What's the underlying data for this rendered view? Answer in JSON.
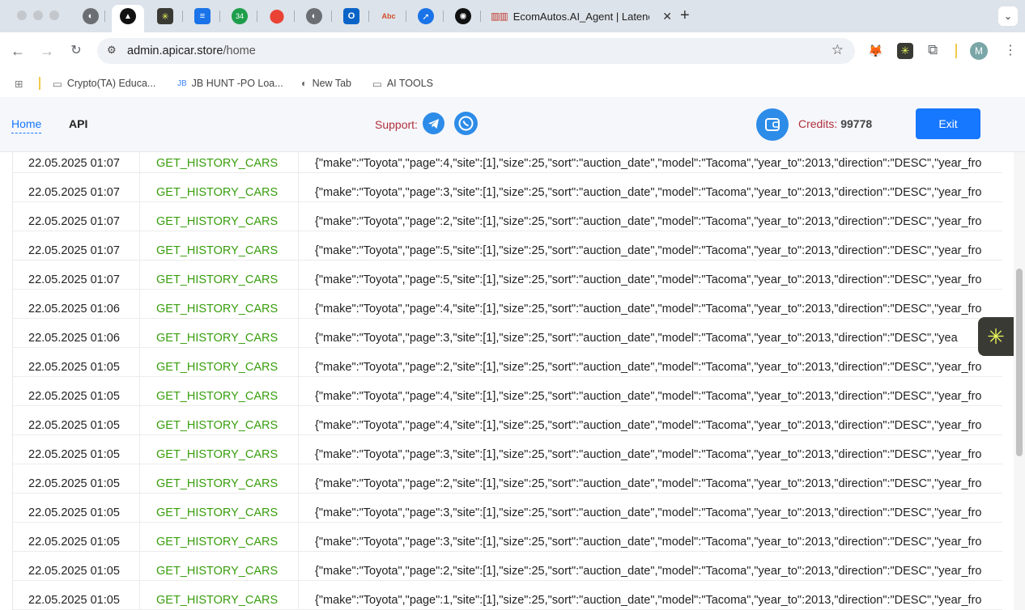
{
  "browser": {
    "active_tab_title": "EcomAutos.AI_Agent | Latenc",
    "url_host": "admin.apicar.store",
    "url_path": "/home",
    "tab_badge_count": "34",
    "tab_text_icon": "Abc",
    "profile_initial": "M",
    "bookmarks": [
      "Crypto(TA) Educa...",
      "JB HUNT -PO Loa...",
      "New Tab",
      "AI TOOLS"
    ]
  },
  "header": {
    "nav_home": "Home",
    "nav_api": "API",
    "support_label": "Support:",
    "credits_label": "Credits:",
    "credits_value": "99778",
    "exit_label": "Exit"
  },
  "table": {
    "rows": [
      {
        "time": "22.05.2025 01:07",
        "method": "GET_HISTORY_CARS",
        "params": "{\"make\":\"Toyota\",\"page\":4,\"site\":[1],\"size\":25,\"sort\":\"auction_date\",\"model\":\"Tacoma\",\"year_to\":2013,\"direction\":\"DESC\",\"year_fro"
      },
      {
        "time": "22.05.2025 01:07",
        "method": "GET_HISTORY_CARS",
        "params": "{\"make\":\"Toyota\",\"page\":3,\"site\":[1],\"size\":25,\"sort\":\"auction_date\",\"model\":\"Tacoma\",\"year_to\":2013,\"direction\":\"DESC\",\"year_fro"
      },
      {
        "time": "22.05.2025 01:07",
        "method": "GET_HISTORY_CARS",
        "params": "{\"make\":\"Toyota\",\"page\":2,\"site\":[1],\"size\":25,\"sort\":\"auction_date\",\"model\":\"Tacoma\",\"year_to\":2013,\"direction\":\"DESC\",\"year_fro"
      },
      {
        "time": "22.05.2025 01:07",
        "method": "GET_HISTORY_CARS",
        "params": "{\"make\":\"Toyota\",\"page\":5,\"site\":[1],\"size\":25,\"sort\":\"auction_date\",\"model\":\"Tacoma\",\"year_to\":2013,\"direction\":\"DESC\",\"year_fro"
      },
      {
        "time": "22.05.2025 01:07",
        "method": "GET_HISTORY_CARS",
        "params": "{\"make\":\"Toyota\",\"page\":5,\"site\":[1],\"size\":25,\"sort\":\"auction_date\",\"model\":\"Tacoma\",\"year_to\":2013,\"direction\":\"DESC\",\"year_fro"
      },
      {
        "time": "22.05.2025 01:06",
        "method": "GET_HISTORY_CARS",
        "params": "{\"make\":\"Toyota\",\"page\":4,\"site\":[1],\"size\":25,\"sort\":\"auction_date\",\"model\":\"Tacoma\",\"year_to\":2013,\"direction\":\"DESC\",\"year_fro"
      },
      {
        "time": "22.05.2025 01:06",
        "method": "GET_HISTORY_CARS",
        "params": "{\"make\":\"Toyota\",\"page\":3,\"site\":[1],\"size\":25,\"sort\":\"auction_date\",\"model\":\"Tacoma\",\"year_to\":2013,\"direction\":\"DESC\",\"yea"
      },
      {
        "time": "22.05.2025 01:05",
        "method": "GET_HISTORY_CARS",
        "params": "{\"make\":\"Toyota\",\"page\":2,\"site\":[1],\"size\":25,\"sort\":\"auction_date\",\"model\":\"Tacoma\",\"year_to\":2013,\"direction\":\"DESC\",\"year_fro"
      },
      {
        "time": "22.05.2025 01:05",
        "method": "GET_HISTORY_CARS",
        "params": "{\"make\":\"Toyota\",\"page\":4,\"site\":[1],\"size\":25,\"sort\":\"auction_date\",\"model\":\"Tacoma\",\"year_to\":2013,\"direction\":\"DESC\",\"year_fro"
      },
      {
        "time": "22.05.2025 01:05",
        "method": "GET_HISTORY_CARS",
        "params": "{\"make\":\"Toyota\",\"page\":4,\"site\":[1],\"size\":25,\"sort\":\"auction_date\",\"model\":\"Tacoma\",\"year_to\":2013,\"direction\":\"DESC\",\"year_fro"
      },
      {
        "time": "22.05.2025 01:05",
        "method": "GET_HISTORY_CARS",
        "params": "{\"make\":\"Toyota\",\"page\":3,\"site\":[1],\"size\":25,\"sort\":\"auction_date\",\"model\":\"Tacoma\",\"year_to\":2013,\"direction\":\"DESC\",\"year_fro"
      },
      {
        "time": "22.05.2025 01:05",
        "method": "GET_HISTORY_CARS",
        "params": "{\"make\":\"Toyota\",\"page\":2,\"site\":[1],\"size\":25,\"sort\":\"auction_date\",\"model\":\"Tacoma\",\"year_to\":2013,\"direction\":\"DESC\",\"year_fro"
      },
      {
        "time": "22.05.2025 01:05",
        "method": "GET_HISTORY_CARS",
        "params": "{\"make\":\"Toyota\",\"page\":3,\"site\":[1],\"size\":25,\"sort\":\"auction_date\",\"model\":\"Tacoma\",\"year_to\":2013,\"direction\":\"DESC\",\"year_fro"
      },
      {
        "time": "22.05.2025 01:05",
        "method": "GET_HISTORY_CARS",
        "params": "{\"make\":\"Toyota\",\"page\":3,\"site\":[1],\"size\":25,\"sort\":\"auction_date\",\"model\":\"Tacoma\",\"year_to\":2013,\"direction\":\"DESC\",\"year_fro"
      },
      {
        "time": "22.05.2025 01:05",
        "method": "GET_HISTORY_CARS",
        "params": "{\"make\":\"Toyota\",\"page\":2,\"site\":[1],\"size\":25,\"sort\":\"auction_date\",\"model\":\"Tacoma\",\"year_to\":2013,\"direction\":\"DESC\",\"year_fro"
      },
      {
        "time": "22.05.2025 01:05",
        "method": "GET_HISTORY_CARS",
        "params": "{\"make\":\"Toyota\",\"page\":1,\"site\":[1],\"size\":25,\"sort\":\"auction_date\",\"model\":\"Tacoma\",\"year_to\":2013,\"direction\":\"DESC\",\"year_fro"
      }
    ]
  },
  "colors": {
    "accent": "#1677ff",
    "method_text": "#389e0d",
    "label_red": "#b0303c",
    "support_icon": "#2d8ce8"
  }
}
